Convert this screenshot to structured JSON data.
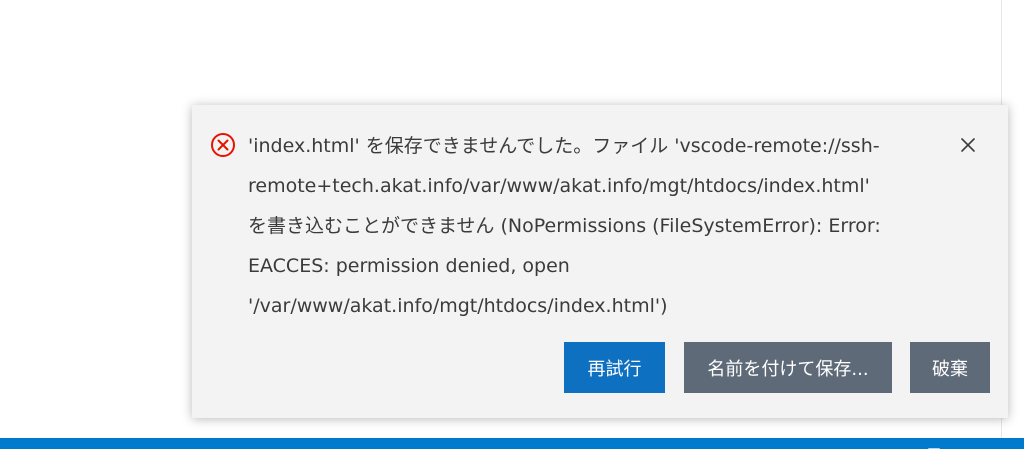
{
  "notification": {
    "message_lines": [
      "'index.html' を保存できませんでした。ファイル 'vscode-remote://ssh-",
      "remote+tech.akat.info/var/www/akat.info/mgt/htdocs/index.html'",
      "を書き込むことができません (NoPermissions (FileSystemError): Error:",
      "EACCES: permission denied, open",
      "'/var/www/akat.info/mgt/htdocs/index.html')"
    ],
    "icon": "error-circle-x-icon",
    "close_icon": "close-icon",
    "buttons": {
      "retry": "再試行",
      "save_as": "名前を付けて保存...",
      "discard": "破棄"
    }
  },
  "colors": {
    "error_icon": "#e51400",
    "primary_button": "#0e70c0",
    "secondary_button": "#5f6a79",
    "notification_bg": "#f3f3f3",
    "status_bar": "#007acc",
    "message_text": "#3b3b3b"
  },
  "status_bar": {
    "icons": [
      "status-bell-icon",
      "status-feedback-icon"
    ]
  }
}
